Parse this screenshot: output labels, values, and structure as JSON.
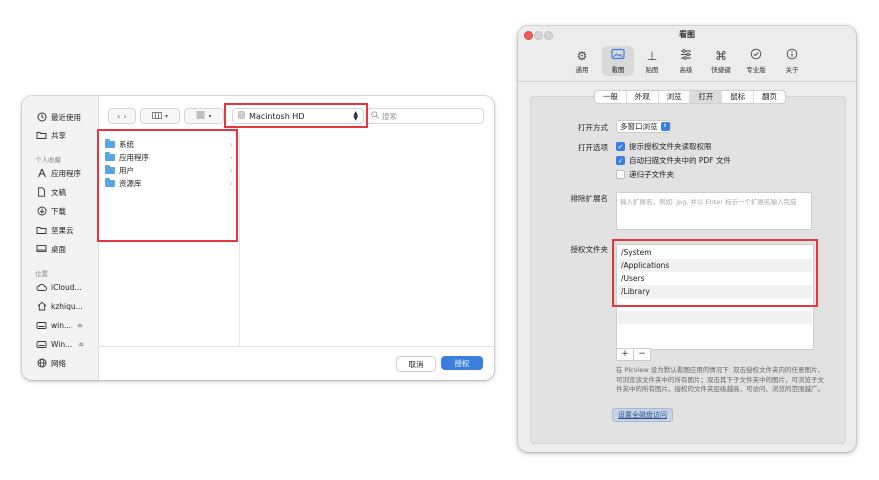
{
  "file_panel": {
    "sidebar": {
      "items_top": [
        {
          "icon": "recents-clock-icon",
          "label": "最近使用"
        },
        {
          "icon": "shared-folder-icon",
          "label": "共享"
        }
      ],
      "personal_header": "个人收藏",
      "items_personal": [
        {
          "icon": "applications-icon",
          "label": "应用程序"
        },
        {
          "icon": "document-icon",
          "label": "文稿"
        },
        {
          "icon": "download-icon",
          "label": "下载"
        },
        {
          "icon": "folder-icon",
          "label": "坚果云"
        },
        {
          "icon": "desktop-icon",
          "label": "桌面"
        }
      ],
      "locations_header": "位置",
      "items_locations": [
        {
          "icon": "cloud-icon",
          "label": "iCloud..."
        },
        {
          "icon": "home-icon",
          "label": "kzhiqu..."
        },
        {
          "icon": "disk-icon",
          "label": "win..."
        },
        {
          "icon": "disk-icon",
          "label": "Win..."
        },
        {
          "icon": "network-globe-icon",
          "label": "网络"
        }
      ]
    },
    "location_select": "Macintosh HD",
    "search_placeholder": "搜索",
    "folders": [
      "系统",
      "应用程序",
      "用户",
      "资源库"
    ],
    "cancel_label": "取消",
    "authorize_label": "授权",
    "accent_color": "#3a7ee0",
    "highlight_color": "#e8363e"
  },
  "prefs": {
    "window_title": "看图",
    "toolbar": [
      {
        "icon": "gear-icon",
        "label": "通用"
      },
      {
        "icon": "photo-icon",
        "label": "看图"
      },
      {
        "icon": "pin-icon",
        "label": "贴图"
      },
      {
        "icon": "sliders-icon",
        "label": "高级"
      },
      {
        "icon": "command-key-icon",
        "label": "快捷键"
      },
      {
        "icon": "badge-check-icon",
        "label": "专业版"
      },
      {
        "icon": "info-icon",
        "label": "关于"
      }
    ],
    "active_tool": 1,
    "tabs": [
      "一般",
      "外观",
      "浏览",
      "打开",
      "鼠标",
      "翻页"
    ],
    "active_tab": 3,
    "open_mode_label": "打开方式",
    "open_mode_value": "多窗口浏览",
    "open_options_label": "打开选项",
    "options": [
      {
        "label": "提示授权文件夹读取权限",
        "checked": true
      },
      {
        "label": "自动扫描文件夹中的 PDF 文件",
        "checked": true
      },
      {
        "label": "递归子文件夹",
        "checked": false
      }
    ],
    "exclude_label": "排除扩展名",
    "exclude_placeholder": "输入扩展名，例如: jpg, 并以 Enter 标示一个扩展名输入完成",
    "auth_folders_label": "授权文件夹",
    "auth_folders": [
      "/System",
      "/Applications",
      "/Users",
      "/Library"
    ],
    "add_label": "+",
    "remove_label": "−",
    "note": "在 Picview 设为默认看图应用的情况下: 双击授权文件夹内的任意图片，可浏览该文件夹中的所有图片；双击其下子文件夹中的图片，可浏览子文件夹中的所有图片。授权的文件夹层级越高，可访问、浏览的范围越广。",
    "full_disk_button": "设置全磁盘访问"
  }
}
